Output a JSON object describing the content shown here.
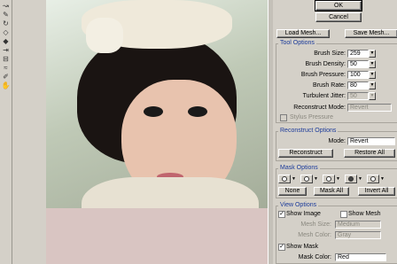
{
  "tools": [
    "warp-tool",
    "reconstruct-tool",
    "twirl-tool",
    "pucker-tool",
    "bloat-tool",
    "push-tool",
    "mirror-tool",
    "turbulence-tool",
    "freeze-mask-tool",
    "thaw-mask-tool",
    "hand-tool",
    "zoom-tool"
  ],
  "dialog": {
    "ok_label": "OK",
    "cancel_label": "Cancel",
    "load_mesh_label": "Load Mesh...",
    "save_mesh_label": "Save Mesh..."
  },
  "tool_options": {
    "title": "Tool Options",
    "brush_size_label": "Brush Size:",
    "brush_size_value": "259",
    "brush_density_label": "Brush Density:",
    "brush_density_value": "50",
    "brush_pressure_label": "Brush Pressure:",
    "brush_pressure_value": "100",
    "brush_rate_label": "Brush Rate:",
    "brush_rate_value": "80",
    "turbulent_jitter_label": "Turbulent Jitter:",
    "turbulent_jitter_value": "50",
    "reconstruct_mode_label": "Reconstruct Mode:",
    "reconstruct_mode_value": "Revert",
    "stylus_pressure_label": "Stylus Pressure"
  },
  "reconstruct_options": {
    "title": "Reconstruct Options",
    "mode_label": "Mode:",
    "mode_value": "Revert",
    "reconstruct_label": "Reconstruct",
    "restore_all_label": "Restore All"
  },
  "mask_options": {
    "title": "Mask Options",
    "none_label": "None",
    "mask_all_label": "Mask All",
    "invert_all_label": "Invert All"
  },
  "view_options": {
    "title": "View Options",
    "show_image_label": "Show Image",
    "show_mesh_label": "Show Mesh",
    "mesh_size_label": "Mesh Size:",
    "mesh_size_value": "Medium",
    "mesh_color_label": "Mesh Color:",
    "mesh_color_value": "Gray",
    "show_mask_label": "Show Mask",
    "mask_color_label": "Mask Color:",
    "mask_color_value": "Red"
  }
}
